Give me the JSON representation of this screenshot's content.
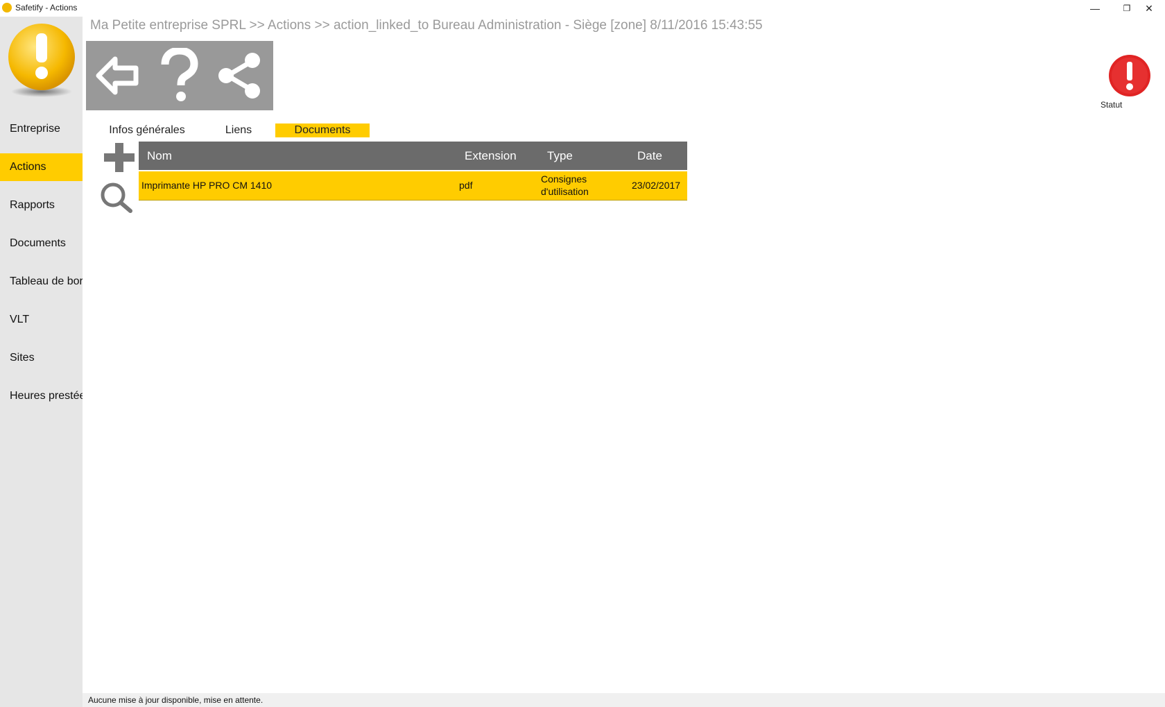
{
  "window": {
    "title": "Safetify - Actions",
    "controls": {
      "minimize": "—",
      "restore": "❐",
      "close": "✕"
    }
  },
  "breadcrumb": "Ma Petite entreprise SPRL >> Actions >> action_linked_to Bureau Administration - Siège [zone]  8/11/2016 15:43:55",
  "sidebar": {
    "items": [
      {
        "label": "Entreprise"
      },
      {
        "label": "Actions"
      },
      {
        "label": "Rapports"
      },
      {
        "label": "Documents"
      },
      {
        "label": "Tableau de bord"
      },
      {
        "label": "VLT"
      },
      {
        "label": "Sites"
      },
      {
        "label": "Heures prestées"
      }
    ],
    "active": "Actions"
  },
  "toolbar": {
    "icons": [
      "back-arrow-icon",
      "help-icon",
      "share-icon"
    ]
  },
  "status_indicator": {
    "label": "Statut",
    "icon": "alert-icon",
    "color": "#e02424"
  },
  "tabs": [
    {
      "label": "Infos générales"
    },
    {
      "label": "Liens"
    },
    {
      "label": "Documents"
    }
  ],
  "active_tab": "Documents",
  "documents_table": {
    "columns": [
      "Nom",
      "Extension",
      "Type",
      "Date"
    ],
    "rows": [
      {
        "nom": "Imprimante HP PRO CM 1410",
        "extension": "pdf",
        "type_line1": "Consignes",
        "type_line2": "d'utilisation",
        "date": "23/02/2017"
      }
    ]
  },
  "status_bar": "Aucune mise à jour disponible, mise en attente.",
  "colors": {
    "accent": "#ffcc00",
    "toolbar": "#999999",
    "header": "#6b6b6b",
    "sidebar": "#e6e6e6"
  }
}
